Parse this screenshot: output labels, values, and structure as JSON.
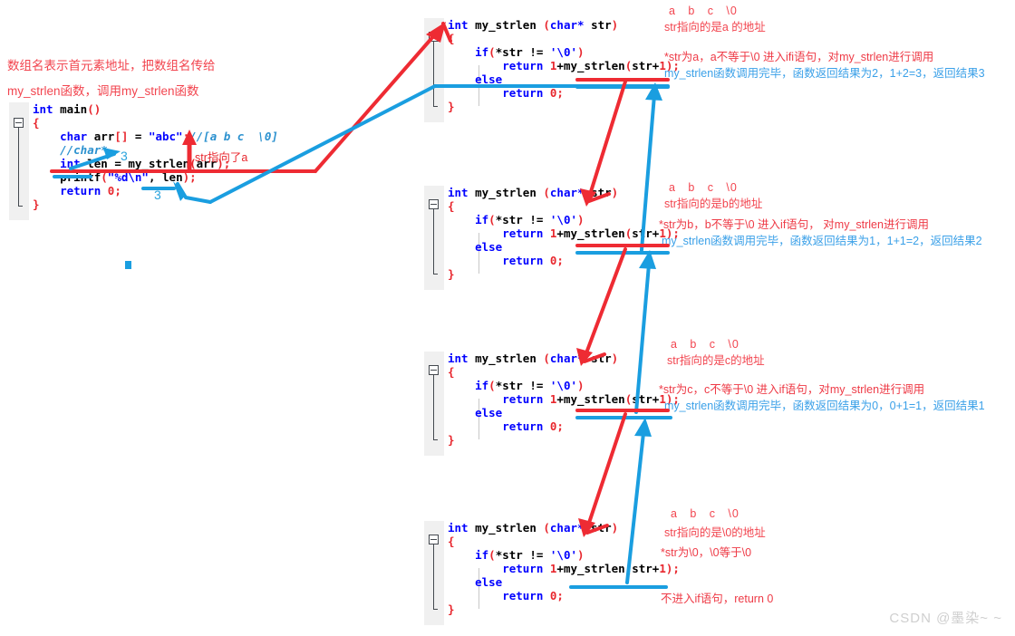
{
  "meta": {
    "watermark": "CSDN @墨染~ ~",
    "colors": {
      "red": "#e8272e",
      "marker_red": "#ee2b33",
      "marker_blue": "#1a9ee0",
      "anno_red": "#f2454f",
      "anno_blue": "#3aa0e8",
      "keyword_blue": "#0000ff",
      "comment_blue": "#2b91cf",
      "gutter_gray": "#f0f0f0",
      "watermark_gray": "#cfcfcf"
    }
  },
  "title_note": {
    "line1": "数组名表示首元素地址，把数组名传给",
    "line2": "my_strlen函数，调用my_strlen函数"
  },
  "main_block": {
    "name": "main-function-code",
    "lines": [
      [
        {
          "t": "int ",
          "c": "kw"
        },
        {
          "t": "main",
          "c": "plain"
        },
        {
          "t": "()",
          "c": "pun"
        }
      ],
      [
        {
          "t": "{",
          "c": "pun"
        }
      ],
      [
        {
          "t": "    char ",
          "c": "kw"
        },
        {
          "t": "arr",
          "c": "plain"
        },
        {
          "t": "[]",
          "c": "pun"
        },
        {
          "t": " = ",
          "c": "plain"
        },
        {
          "t": "\"abc\"",
          "c": "str"
        },
        {
          "t": ";",
          "c": "pun"
        },
        {
          "t": "//[a b c  \\0]",
          "c": "cmt"
        }
      ],
      [
        {
          "t": "    //char*",
          "c": "cmt"
        }
      ],
      [
        {
          "t": "    int ",
          "c": "kw"
        },
        {
          "t": "len = my_strlen",
          "c": "plain"
        },
        {
          "t": "(",
          "c": "pun"
        },
        {
          "t": "arr",
          "c": "plain"
        },
        {
          "t": ")",
          "c": "pun"
        },
        {
          "t": ";",
          "c": "pun"
        }
      ],
      [
        {
          "t": "    printf",
          "c": "plain"
        },
        {
          "t": "(",
          "c": "pun"
        },
        {
          "t": "\"%d\\n\"",
          "c": "str"
        },
        {
          "t": ", ",
          "c": "plain"
        },
        {
          "t": "len",
          "c": "plain"
        },
        {
          "t": ")",
          "c": "pun"
        },
        {
          "t": ";",
          "c": "pun"
        }
      ],
      [
        {
          "t": "    return ",
          "c": "kw"
        },
        {
          "t": "0",
          "c": "num"
        },
        {
          "t": ";",
          "c": "pun"
        }
      ],
      [
        {
          "t": "}",
          "c": "pun"
        }
      ]
    ]
  },
  "strlen_block": {
    "name": "my-strlen-function-code",
    "lines": [
      [
        {
          "t": "int ",
          "c": "kw"
        },
        {
          "t": "my_strlen ",
          "c": "plain"
        },
        {
          "t": "(",
          "c": "pun"
        },
        {
          "t": "char*",
          "c": "kw"
        },
        {
          "t": " str",
          "c": "plain"
        },
        {
          "t": ")",
          "c": "pun"
        }
      ],
      [
        {
          "t": "{",
          "c": "pun"
        }
      ],
      [
        {
          "t": "    if",
          "c": "kw"
        },
        {
          "t": "(",
          "c": "pun"
        },
        {
          "t": "*str != ",
          "c": "plain"
        },
        {
          "t": "'\\0'",
          "c": "str"
        },
        {
          "t": ")",
          "c": "pun"
        }
      ],
      [
        {
          "t": "        return ",
          "c": "kw"
        },
        {
          "t": "1",
          "c": "num"
        },
        {
          "t": "+my_strlen",
          "c": "plain"
        },
        {
          "t": "(",
          "c": "pun"
        },
        {
          "t": "str",
          "c": "plain"
        },
        {
          "t": "+",
          "c": "plain"
        },
        {
          "t": "1",
          "c": "num"
        },
        {
          "t": ")",
          "c": "pun"
        },
        {
          "t": ";",
          "c": "pun"
        }
      ],
      [
        {
          "t": "    else",
          "c": "kw"
        }
      ],
      [
        {
          "t": "        return ",
          "c": "kw"
        },
        {
          "t": "0",
          "c": "num"
        },
        {
          "t": ";",
          "c": "pun"
        }
      ],
      [
        {
          "t": "}",
          "c": "pun"
        }
      ]
    ]
  },
  "inline_labels": {
    "str_points_to_a": "str指向了a",
    "ret_main_top": "3",
    "ret_main_bottom": "3"
  },
  "annotations": [
    {
      "id": "call-1",
      "chars": "a   b   c   \\0",
      "addr": "str指向的是a 的地址",
      "red_line": "*str为a，a不等于\\0 进入ifi语句，对my_strlen进行调用",
      "blue_line": "my_strlen函数调用完毕，函数返回结果为2，1+2=3，返回结果3"
    },
    {
      "id": "call-2",
      "chars": "a   b   c   \\0",
      "addr": "str指向的是b的地址",
      "red_line": "*str为b，b不等于\\0 进入if语句， 对my_strlen进行调用",
      "blue_line": "my_strlen函数调用完毕，函数返回结果为1，1+1=2，返回结果2"
    },
    {
      "id": "call-3",
      "chars": "a   b   c   \\0",
      "addr": "str指向的是c的地址",
      "red_line": "*str为c，c不等于\\0 进入if语句，对my_strlen进行调用",
      "blue_line": "my_strlen函数调用完毕，函数返回结果为0，0+1=1，返回结果1"
    },
    {
      "id": "call-4",
      "chars": "a   b   c   \\0",
      "addr": "str指向的是\\0的地址",
      "red_line": "*str为\\0，\\0等于\\0",
      "blue_line": "",
      "extra": "不进入if语句，return 0"
    }
  ]
}
